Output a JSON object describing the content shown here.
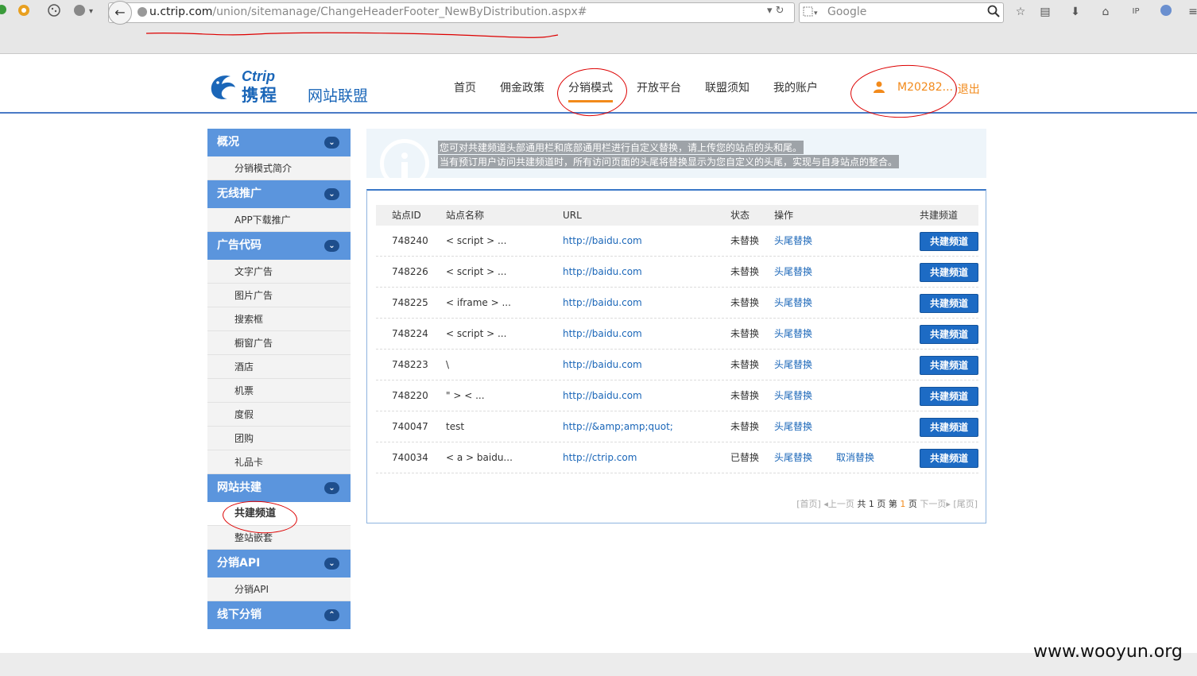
{
  "browser": {
    "url_domain": "u.ctrip.com",
    "url_path": "/union/sitemanage/ChangeHeaderFooter_NewByDistribution.aspx#",
    "search_placeholder": "Google"
  },
  "header": {
    "logo_ctrip": "Ctrip",
    "logo_cn": "携程",
    "logo_sub": "网站联盟",
    "nav": [
      "首页",
      "佣金政策",
      "分销模式",
      "开放平台",
      "联盟须知",
      "我的账户"
    ],
    "active_nav": "分销模式",
    "username": "M20282...",
    "logout": "退出"
  },
  "sidebar": {
    "sections": [
      {
        "title": "概况",
        "chev": "⌄",
        "items": [
          "分销模式简介"
        ]
      },
      {
        "title": "无线推广",
        "chev": "⌄",
        "items": [
          "APP下载推广"
        ]
      },
      {
        "title": "广告代码",
        "chev": "⌄",
        "items": [
          "文字广告",
          "图片广告",
          "搜索框",
          "橱窗广告",
          "酒店",
          "机票",
          "度假",
          "团购",
          "礼品卡"
        ]
      },
      {
        "title": "网站共建",
        "chev": "⌄",
        "items": [
          "共建频道",
          "整站嵌套"
        ]
      },
      {
        "title": "分销API",
        "chev": "⌄",
        "items": [
          "分销API"
        ]
      },
      {
        "title": "线下分销",
        "chev": "⌃",
        "items": []
      }
    ],
    "active_item": "共建频道"
  },
  "notice": {
    "line1": "您可对共建频道头部通用栏和底部通用栏进行自定义替换，请上传您的站点的头和尾。",
    "line2": "当有预订用户访问共建频道时，所有访问页面的头尾将替换显示为您自定义的头尾，实现与自身站点的整合。"
  },
  "table": {
    "headers": [
      "站点ID",
      "站点名称",
      "URL",
      "状态",
      "操作",
      "共建频道"
    ],
    "rows": [
      {
        "id": "748240",
        "name": "< script > ...",
        "url": "http://baidu.com",
        "status": "未替换",
        "op": "头尾替换",
        "op2": "",
        "btn": "共建频道"
      },
      {
        "id": "748226",
        "name": "< script > ...",
        "url": "http://baidu.com",
        "status": "未替换",
        "op": "头尾替换",
        "op2": "",
        "btn": "共建频道"
      },
      {
        "id": "748225",
        "name": "< iframe > ...",
        "url": "http://baidu.com",
        "status": "未替换",
        "op": "头尾替换",
        "op2": "",
        "btn": "共建频道"
      },
      {
        "id": "748224",
        "name": "< script > ...",
        "url": "http://baidu.com",
        "status": "未替换",
        "op": "头尾替换",
        "op2": "",
        "btn": "共建频道"
      },
      {
        "id": "748223",
        "name": "\\",
        "url": "http://baidu.com",
        "status": "未替换",
        "op": "头尾替换",
        "op2": "",
        "btn": "共建频道"
      },
      {
        "id": "748220",
        "name": "\" > < ...",
        "url": "http://baidu.com",
        "status": "未替换",
        "op": "头尾替换",
        "op2": "",
        "btn": "共建频道"
      },
      {
        "id": "740047",
        "name": "test",
        "url": "http://&amp;amp;quot;",
        "status": "未替换",
        "op": "头尾替换",
        "op2": "",
        "btn": "共建频道"
      },
      {
        "id": "740034",
        "name": "< a > baidu...",
        "url": "http://ctrip.com",
        "status": "已替换",
        "op": "头尾替换",
        "op2": "取消替换",
        "btn": "共建频道"
      }
    ]
  },
  "pager": {
    "first": "[首页]",
    "prev": "上一页",
    "total_prefix": "共",
    "total": "1",
    "total_suffix": "页",
    "page_prefix": "第",
    "page": "1",
    "page_suffix": "页",
    "next": "下一页",
    "last": "[尾页]"
  },
  "watermark": "www.wooyun.org"
}
